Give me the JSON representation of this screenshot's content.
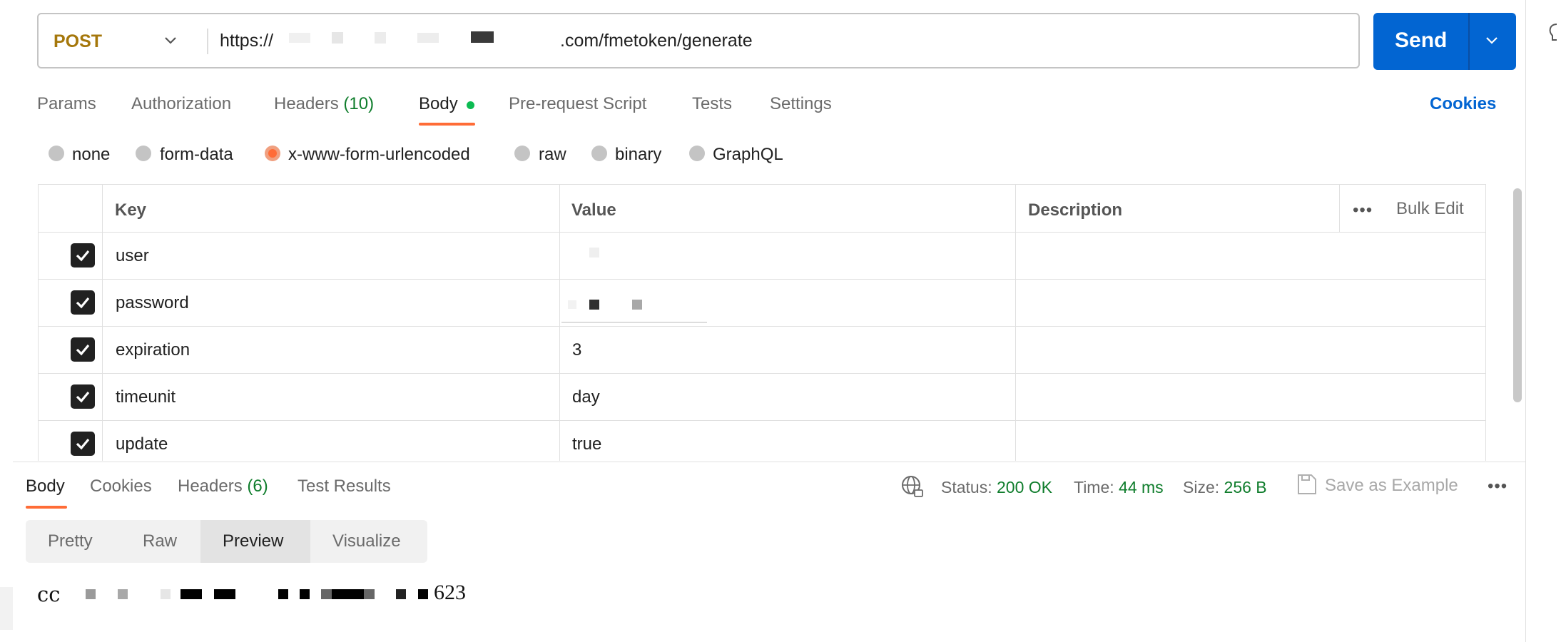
{
  "request": {
    "method": "POST",
    "url_prefix": "https://",
    "url_suffix": ".com/fmetoken/generate",
    "send_label": "Send"
  },
  "request_tabs": {
    "params": "Params",
    "authorization": "Authorization",
    "headers_label": "Headers",
    "headers_count": "(10)",
    "body": "Body",
    "pre_request": "Pre-request Script",
    "tests": "Tests",
    "settings": "Settings",
    "cookies": "Cookies"
  },
  "body_types": [
    {
      "label": "none",
      "selected": false
    },
    {
      "label": "form-data",
      "selected": false
    },
    {
      "label": "x-www-form-urlencoded",
      "selected": true
    },
    {
      "label": "raw",
      "selected": false
    },
    {
      "label": "binary",
      "selected": false
    },
    {
      "label": "GraphQL",
      "selected": false
    }
  ],
  "params_table": {
    "headers": {
      "key": "Key",
      "value": "Value",
      "description": "Description",
      "bulk_edit": "Bulk Edit"
    },
    "rows": [
      {
        "key": "user",
        "value": "",
        "checked": true
      },
      {
        "key": "password",
        "value": "",
        "checked": true
      },
      {
        "key": "expiration",
        "value": "3",
        "checked": true
      },
      {
        "key": "timeunit",
        "value": "day",
        "checked": true
      },
      {
        "key": "update",
        "value": "true",
        "checked": true
      }
    ]
  },
  "response": {
    "tabs": {
      "body": "Body",
      "cookies": "Cookies",
      "headers_label": "Headers",
      "headers_count": "(6)",
      "test_results": "Test Results"
    },
    "status_label": "Status:",
    "status_value": "200 OK",
    "time_label": "Time:",
    "time_value": "44 ms",
    "size_label": "Size:",
    "size_value": "256 B",
    "save_example": "Save as Example",
    "views": [
      "Pretty",
      "Raw",
      "Preview",
      "Visualize"
    ],
    "active_view": "Preview",
    "preview_start": "cc",
    "preview_end": "623"
  },
  "colors": {
    "accent": "#ff6c37",
    "send_blue": "#0265d2",
    "method_post": "#a5770b",
    "success_green": "#0f7d2c"
  }
}
